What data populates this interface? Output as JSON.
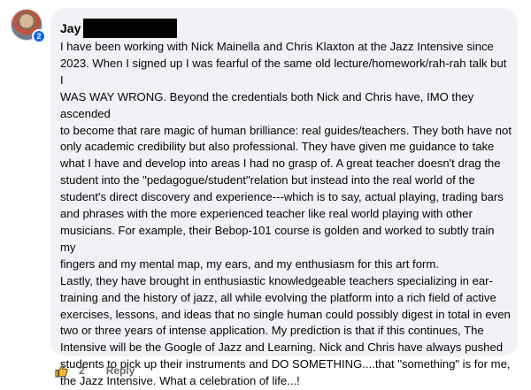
{
  "comment": {
    "author": "Jay",
    "badge": "2",
    "text": "I have been working with Nick Mainella and Chris Klaxton at the Jazz Intensive since\n2023. When I signed up I was fearful of the same old lecture/homework/rah-rah talk but I\nWAS WAY WRONG. Beyond the credentials both Nick and Chris have, IMO they ascended\nto become that rare magic of human brilliance: real guides/teachers. They both have not\nonly academic credibility but also professional. They have given me guidance to take\nwhat I have and develop into areas I had no grasp of. A great teacher doesn't drag the\nstudent into the \"pedagogue/student\"relation but instead into the real world of the\nstudent's direct discovery and experience---which is to say, actual playing, trading bars\nand phrases with the more experienced teacher like real world playing with other\nmusicians. For example, their Bebop-101 course is golden and worked to subtly train my\nfingers and my mental map, my ears, and my enthusiasm for this art form.\nLastly, they have brought in enthusiastic knowledgeable teachers specializing in ear-\ntraining and the history of jazz, all while evolving the platform into a rich field of active\nexercises, lessons, and ideas that no single human could possibly digest in total in even\ntwo or three years of intense application. My prediction is that if this continues, The\nIntensive will be the Google of Jazz and Learning. Nick and Chris have always pushed\nstudents to pick up their instruments and DO SOMETHING....that \"something\" is for me,\nthe Jazz Intensive. What a celebration of life...!"
  },
  "actions": {
    "like_icon": "thumbs-up-icon",
    "like_count": "2",
    "reply_label": "Reply"
  },
  "colors": {
    "bubble": "#f0f2f5",
    "badge": "#0866ff",
    "like": "#f7b928"
  }
}
